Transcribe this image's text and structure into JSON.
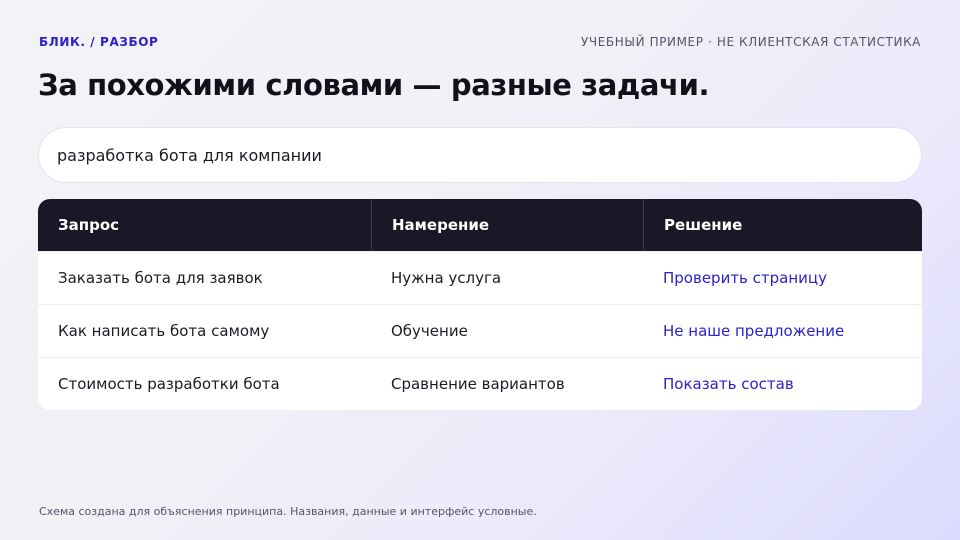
{
  "header": {
    "brand": "БЛИК. / РАЗБОР",
    "note": "УЧЕБНЫЙ ПРИМЕР · НЕ КЛИЕНТСКАЯ СТАТИСТИКА",
    "title": "За похожими словами — разные задачи."
  },
  "search": {
    "value": "разработка бота для компании"
  },
  "table": {
    "columns": [
      "Запрос",
      "Намерение",
      "Решение"
    ],
    "rows": [
      [
        "Заказать бота для заявок",
        "Нужна услуга",
        "Проверить страницу"
      ],
      [
        "Как написать бота самому",
        "Обучение",
        "Не наше предложение"
      ],
      [
        "Стоимость разработки бота",
        "Сравнение вариантов",
        "Показать состав"
      ]
    ]
  },
  "footer": {
    "text": "Схема создана для объяснения принципа. Названия, данные и интерфейс условные."
  },
  "colors": {
    "accent": "#2b22c9",
    "header_bg": "#181826"
  }
}
